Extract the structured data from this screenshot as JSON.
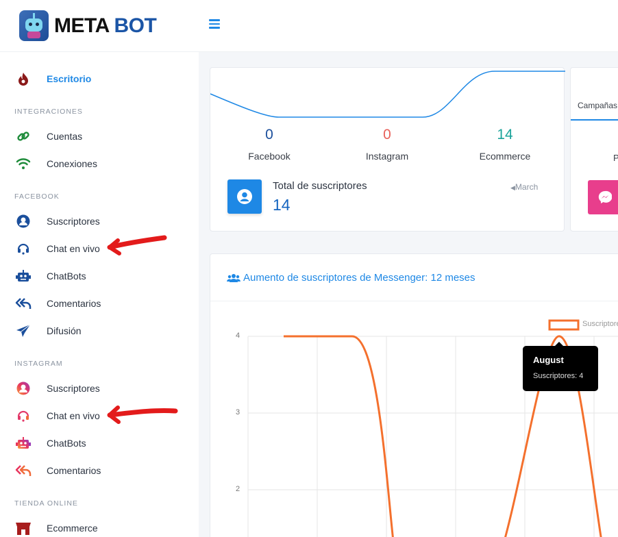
{
  "brand": {
    "name_part1": "META",
    "name_part2": "BOT"
  },
  "sidebar": {
    "dashboard": "Escritorio",
    "sections": {
      "integraciones": "INTEGRACIONES",
      "facebook": "FACEBOOK",
      "instagram": "INSTAGRAM",
      "tienda": "TIENDA ONLINE"
    },
    "integraciones": [
      "Cuentas",
      "Conexiones"
    ],
    "facebook": [
      "Suscriptores",
      "Chat en vivo",
      "ChatBots",
      "Comentarios",
      "Difusión"
    ],
    "instagram": [
      "Suscriptores",
      "Chat en vivo",
      "ChatBots",
      "Comentarios"
    ],
    "tienda": [
      "Ecommerce"
    ]
  },
  "stats": {
    "facebook": {
      "value": "0",
      "label": "Facebook"
    },
    "instagram": {
      "value": "0",
      "label": "Instagram"
    },
    "ecommerce": {
      "value": "14",
      "label": "Ecommerce"
    },
    "total_label": "Total de suscriptores",
    "total_value": "14",
    "month_link": "March"
  },
  "campaigns": {
    "tab_label": "Campañas",
    "partial_text": "P"
  },
  "chart": {
    "title": "Aumento de suscriptores de Messenger: 12 meses",
    "tooltip": {
      "title": "August",
      "body": "Suscriptores: 4"
    },
    "legend": "Suscriptores",
    "y_ticks": [
      "4",
      "3",
      "2"
    ]
  },
  "chart_data": {
    "type": "line",
    "title": "Aumento de suscriptores de Messenger: 12 meses",
    "series": [
      {
        "name": "Suscriptores",
        "color": "#f4702d"
      }
    ],
    "ylim_visible": [
      1.3,
      4
    ],
    "y_ticks": [
      2,
      3,
      4
    ],
    "highlight": {
      "x": "August",
      "y": 4
    }
  },
  "colors": {
    "accent": "#1e88e5",
    "messenger": "#e83e8c",
    "series": "#f4702d",
    "annotation_arrow": "#e31b1b"
  }
}
